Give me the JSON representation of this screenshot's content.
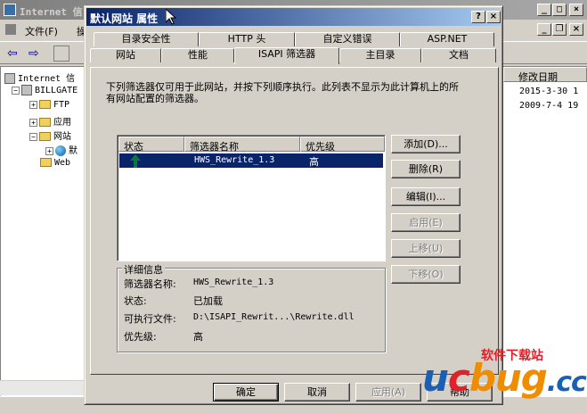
{
  "bg_window": {
    "title": "Internet 信",
    "menu": {
      "file": "文件(F)",
      "action": "操"
    },
    "tree": [
      {
        "label": "Internet 信"
      },
      {
        "label": "BILLGATE"
      },
      {
        "label": "FTP"
      },
      {
        "label": "应用"
      },
      {
        "label": "网站"
      },
      {
        "label": "默"
      },
      {
        "label": "Web"
      }
    ],
    "list": {
      "header": "修改日期",
      "rows": [
        "2015-3-30 1",
        "2009-7-4 19"
      ]
    }
  },
  "dialog": {
    "title": "默认网站 属性",
    "tabs_top": [
      "目录安全性",
      "HTTP 头",
      "自定义错误",
      "ASP.NET"
    ],
    "tabs_bottom": [
      "网站",
      "性能",
      "ISAPI 筛选器",
      "主目录",
      "文档"
    ],
    "description": "下列筛选器仅可用于此网站，并按下列顺序执行。此列表不显示为此计算机上的所有网站配置的筛选器。",
    "filter_list": {
      "headers": [
        "状态",
        "筛选器名称",
        "优先级"
      ],
      "rows": [
        {
          "status_icon": "up-arrow-icon",
          "name": "HWS_Rewrite_1.3",
          "priority": "高"
        }
      ]
    },
    "side_buttons": {
      "add": "添加(D)...",
      "remove": "删除(R)",
      "edit": "编辑(I)...",
      "enable": "启用(E)",
      "move_up": "上移(U)",
      "move_down": "下移(O)"
    },
    "details": {
      "legend": "详细信息",
      "filter_name_label": "筛选器名称:",
      "filter_name": "HWS_Rewrite_1.3",
      "status_label": "状态:",
      "status": "已加载",
      "executable_label": "可执行文件:",
      "executable": "D:\\ISAPI_Rewrit...\\Rewrite.dll",
      "priority_label": "优先级:",
      "priority": "高"
    },
    "footer_buttons": {
      "ok": "确定",
      "cancel": "取消",
      "apply": "应用(A)",
      "help": "帮助"
    }
  },
  "watermark": {
    "text": "软件下载站",
    "logo_parts": [
      "u",
      "c",
      "bug",
      ".cc"
    ]
  },
  "colors": {
    "face": "#d4d0c8",
    "title_active": "#0a246a",
    "title_gradient_end": "#a6caf0",
    "selection": "#0a246a",
    "arrow_green": "#0a7a3a",
    "watermark_red": "#e0202a",
    "watermark_blue": "#1a5fb4",
    "watermark_orange": "#f08c00"
  }
}
